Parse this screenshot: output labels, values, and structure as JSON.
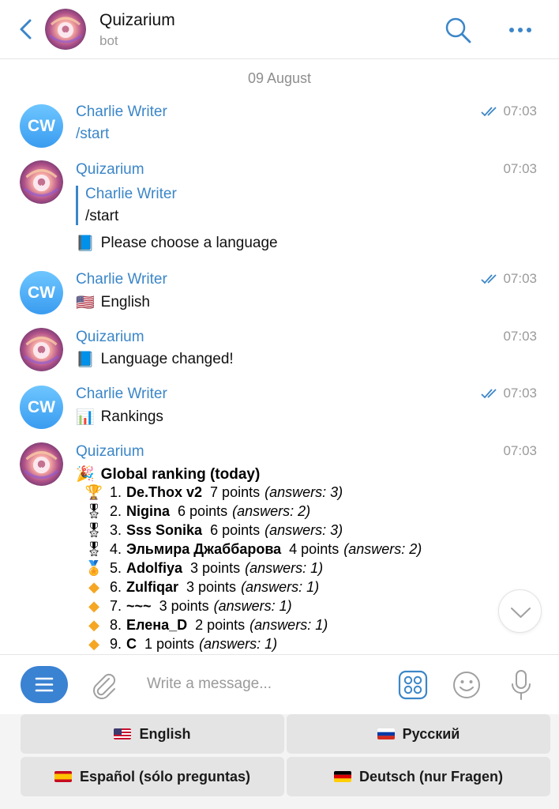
{
  "header": {
    "title": "Quizarium",
    "subtitle": "bot"
  },
  "chat": {
    "date": "09 August",
    "messages": [
      {
        "sender": "Charlie Writer",
        "avatar_text": "CW",
        "time": "07:03",
        "text": "/start"
      },
      {
        "sender": "Quizarium",
        "time": "07:03",
        "quote_name": "Charlie Writer",
        "quote_text": "/start",
        "text": "Please choose a language"
      },
      {
        "sender": "Charlie Writer",
        "avatar_text": "CW",
        "time": "07:03",
        "text": "English"
      },
      {
        "sender": "Quizarium",
        "time": "07:03",
        "text": "Language changed!"
      },
      {
        "sender": "Charlie Writer",
        "avatar_text": "CW",
        "time": "07:03",
        "text": "Rankings"
      },
      {
        "sender": "Quizarium",
        "time": "07:03",
        "text": "Global ranking (today)"
      }
    ],
    "ranking": [
      {
        "pos": "1.",
        "name": "De.Thox v2",
        "points": "7 points",
        "answers": "(answers: 3)",
        "icon": "trophy-icon"
      },
      {
        "pos": "2.",
        "name": "Nigina",
        "points": "6 points",
        "answers": "(answers: 2)",
        "icon": "medal-icon"
      },
      {
        "pos": "3.",
        "name": "Sss Sonika",
        "points": "6 points",
        "answers": "(answers: 3)",
        "icon": "medal-icon"
      },
      {
        "pos": "4.",
        "name": "Эльмира Джаббарова",
        "points": "4 points",
        "answers": "(answers: 2)",
        "icon": "medal-icon"
      },
      {
        "pos": "5.",
        "name": "Adolfiya",
        "points": "3 points",
        "answers": "(answers: 1)",
        "icon": "medal-icon"
      },
      {
        "pos": "6.",
        "name": "Zulfiqar",
        "points": "3 points",
        "answers": "(answers: 1)",
        "icon": "diamond-icon"
      },
      {
        "pos": "7.",
        "name": "~~~",
        "points": "3 points",
        "answers": "(answers: 1)",
        "icon": "diamond-icon"
      },
      {
        "pos": "8.",
        "name": "Елена_D",
        "points": "2 points",
        "answers": "(answers: 1)",
        "icon": "diamond-icon"
      },
      {
        "pos": "9.",
        "name": "C",
        "points": "1 points",
        "answers": "(answers: 1)",
        "icon": "diamond-icon"
      }
    ]
  },
  "composer": {
    "placeholder": "Write a message..."
  },
  "keyboard": {
    "buttons": [
      {
        "label": "English"
      },
      {
        "label": "Русский"
      },
      {
        "label": "Español (sólo preguntas)"
      },
      {
        "label": "Deutsch (nur Fragen)"
      }
    ]
  },
  "colors": {
    "accent": "#3b86c8",
    "menu_button": "#3a82d2",
    "avatar_cw": "#3a9cf0",
    "timestamp": "#9a9a9a"
  }
}
